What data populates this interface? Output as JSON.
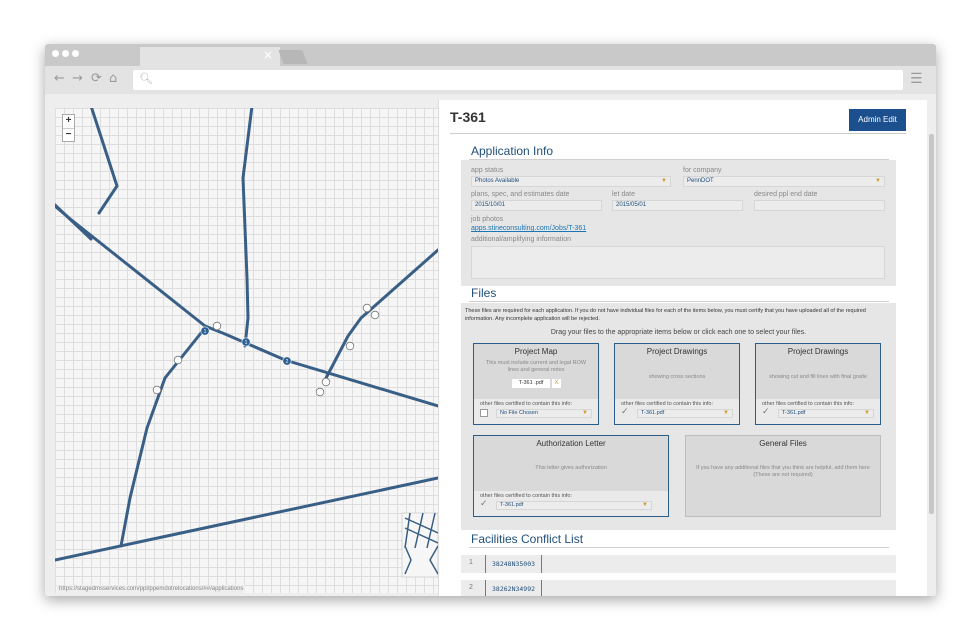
{
  "browser": {
    "tab_close_glyph": "×",
    "nav": {
      "back": "←",
      "forward": "→",
      "reload": "⟳",
      "home": "⌂",
      "menu": "☰"
    },
    "status_url": "https://stagedmsservices.com/ppl/ppemdotrelocations/##/applications"
  },
  "map": {
    "zoom_in": "+",
    "zoom_out": "−",
    "markers": [
      "1",
      "1",
      "2"
    ],
    "line_color": "#3a5f86"
  },
  "panel": {
    "title": "T-361",
    "admin_button": "Admin Edit",
    "application_info": {
      "heading": "Application Info",
      "app_status_label": "app status",
      "app_status_value": "Photos Available",
      "for_company_label": "for company",
      "for_company_value": "PennDOT",
      "plans_label": "plans, spec, and estimates date",
      "plans_value": "2015/10/01",
      "let_date_label": "let date",
      "let_date_value": "2015/05/01",
      "desired_label": "desired ppl end date",
      "desired_value": "",
      "job_photos_label": "job photos",
      "job_photos_link": "apps.stineconsulting.com/Jobs/T-361",
      "additional_label": "additional/amplifying information"
    },
    "files": {
      "heading": "Files",
      "notice": "These files are required for each application. If you do not have individual files for each of the items below, you must certify that you have uploaded all of the required information. Any incomplete application will be rejected.",
      "drag_instruction": "Drag your files to the appropriate items below or click each one to select your files.",
      "other_files_label": "other files certified to contain this info:",
      "cards": [
        {
          "title": "Project Map",
          "desc": "This must include current and legal ROW lines and general notes",
          "chip": "T-361 .pdf",
          "chip_x": "X",
          "selected": "No File Chosen"
        },
        {
          "title": "Project Drawings",
          "desc": "showing cross sections",
          "selected": "T-361.pdf"
        },
        {
          "title": "Project Drawings",
          "desc": "showing cut and fill lines with final grade",
          "selected": "T-361.pdf"
        },
        {
          "title": "Authorization Letter",
          "desc": "This letter gives authorization",
          "selected": "T-361.pdf"
        },
        {
          "title": "General Files",
          "desc": "If you have any additional files that you think are helpful, add them here (These are not required)"
        }
      ]
    },
    "facilities": {
      "heading": "Facilities Conflict List",
      "rows": [
        {
          "num": "1",
          "code": "38248N35003"
        },
        {
          "num": "2",
          "code": "38262N34992"
        }
      ]
    }
  },
  "colors": {
    "accent": "#1b4f8e",
    "heading": "#1f4f7a",
    "link": "#1a75b5"
  }
}
